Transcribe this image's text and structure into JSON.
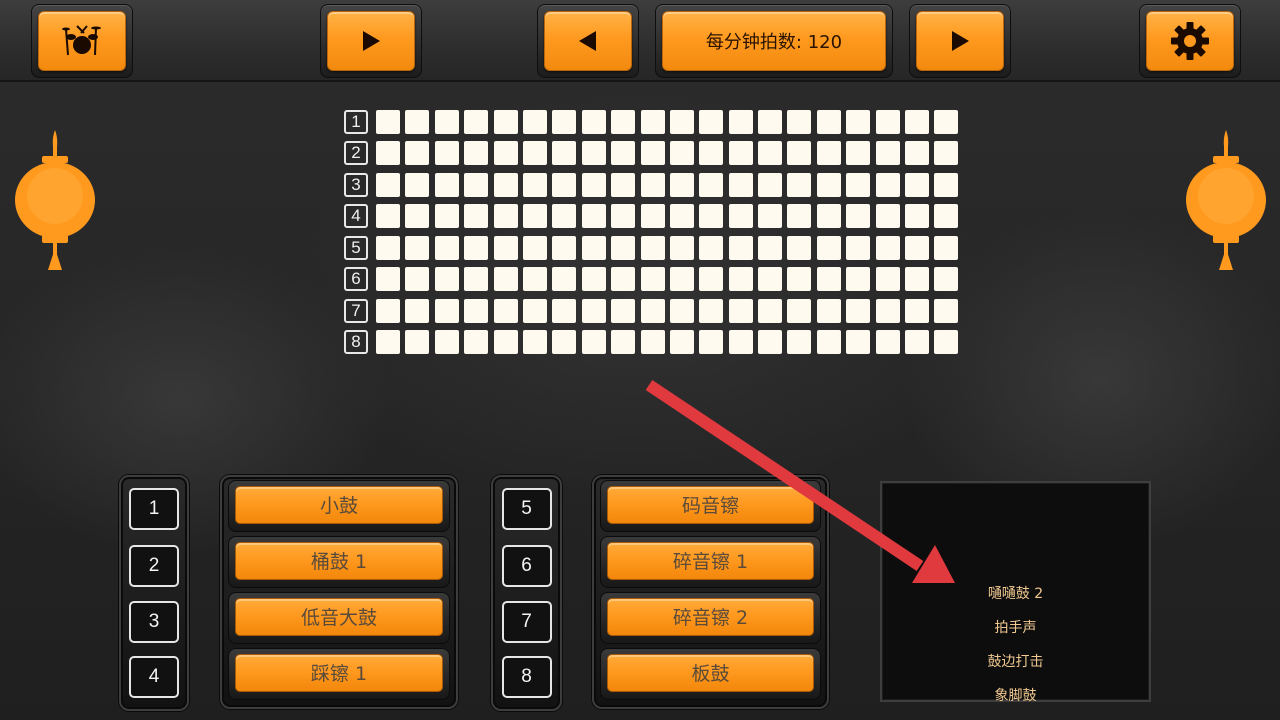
{
  "toolbar": {
    "bpm_label": "每分钟拍数: 120"
  },
  "grid": {
    "rows": [
      "1",
      "2",
      "3",
      "4",
      "5",
      "6",
      "7",
      "8"
    ],
    "steps": 20
  },
  "left_panel": {
    "numbers": [
      "1",
      "2",
      "3",
      "4"
    ],
    "instruments": [
      "小鼓",
      "桶鼓 1",
      "低音大鼓",
      "踩镲 1"
    ]
  },
  "right_panel": {
    "numbers": [
      "5",
      "6",
      "7",
      "8"
    ],
    "instruments": [
      "码音镲",
      "碎音镲 1",
      "碎音镲 2",
      "板鼓"
    ]
  },
  "dropdown": {
    "items": [
      "嗵嗵鼓 2",
      "拍手声",
      "鼓边打击",
      "象脚鼓"
    ]
  },
  "icons": {
    "drum_kit": "drum-kit-icon",
    "play": "play-icon",
    "prev": "triangle-left-icon",
    "next": "triangle-right-icon",
    "settings": "gear-icon",
    "lantern": "lantern-icon",
    "arrow": "arrow-annotation"
  },
  "colors": {
    "accent": "#ff9a1f",
    "cell": "#fffaf0",
    "arrow": "#e0393e",
    "list_text": "#f0c890"
  }
}
